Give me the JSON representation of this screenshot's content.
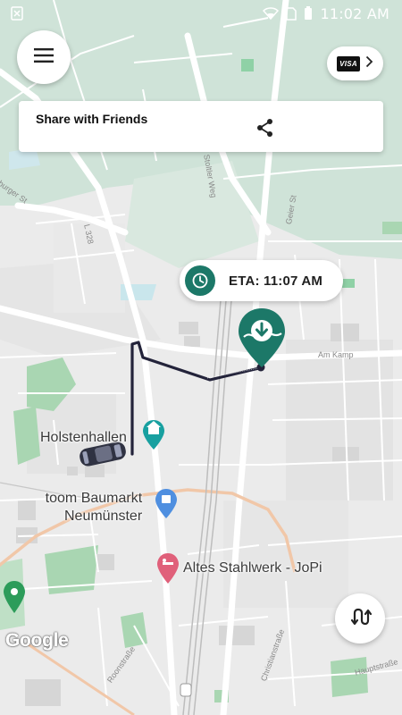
{
  "status_bar": {
    "time": "11:02 AM",
    "icons": [
      "close-notification-icon",
      "wifi-icon",
      "sim-icon",
      "battery-icon"
    ]
  },
  "menu": {
    "icon": "hamburger-menu-icon"
  },
  "payment": {
    "card_brand": "VISA",
    "chevron": "chevron-right-icon"
  },
  "share_card": {
    "title": "Share with Friends",
    "icon": "share-icon"
  },
  "eta": {
    "label": "ETA: 11:07 AM",
    "icon": "clock-icon",
    "accent": "#1c7868"
  },
  "destination_pin": {
    "icon": "download-arrow-icon",
    "color": "#1c7868"
  },
  "route_button": {
    "icon": "route-icon"
  },
  "map": {
    "attribution": "Google",
    "pois": [
      {
        "name": "Holstenhallen",
        "icon": "landmark-icon",
        "color": "#18a0a0"
      },
      {
        "name": "toom Baumarkt\nNeumünster",
        "icon": "shopping-bag-icon",
        "color": "#4f8fe0"
      },
      {
        "name": "Altes Stahlwerk - JoPi",
        "icon": "bed-icon",
        "color": "#e0607a"
      }
    ],
    "streets": [
      "L 328",
      "Am Kamp",
      "Geier St",
      "Roonstraße",
      "Christianstraße",
      "Hauptstraße",
      "burger St",
      "Stoltler Weg"
    ],
    "route_color": "#23233a"
  }
}
